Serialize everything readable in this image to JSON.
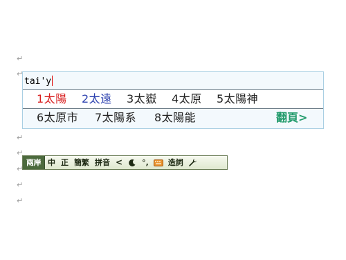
{
  "document": {
    "paragraph_mark": "↵"
  },
  "ime": {
    "composition": "tai'y",
    "candidates_row1": [
      {
        "label": "1太陽"
      },
      {
        "label": "2太遠"
      },
      {
        "label": "3太嶽"
      },
      {
        "label": "4太原"
      },
      {
        "label": "5太陽神"
      }
    ],
    "candidates_row2": [
      {
        "label": "6太原市"
      },
      {
        "label": "7太陽系"
      },
      {
        "label": "8太陽能"
      }
    ],
    "page_button": "翻頁>"
  },
  "toolbar": {
    "mode": "兩岸",
    "chinese": "中",
    "zheng": "正",
    "simp_trad": "簡繁",
    "pinyin": "拼音",
    "chevron": "<",
    "punct": "°,",
    "create_word": "造詞",
    "icons": {
      "half_full_width": "moon-icon",
      "soft_keyboard": "keyboard-icon",
      "settings": "wrench-icon"
    },
    "colors": {
      "mode_bg": "#4c6a3d",
      "bar_bg": "#dfe8cf"
    }
  },
  "colors": {
    "selected_candidate": "#d81e1e",
    "second_candidate": "#2a3fae",
    "page_button": "#1f9a6a",
    "ime_border": "#a9cfe3"
  }
}
